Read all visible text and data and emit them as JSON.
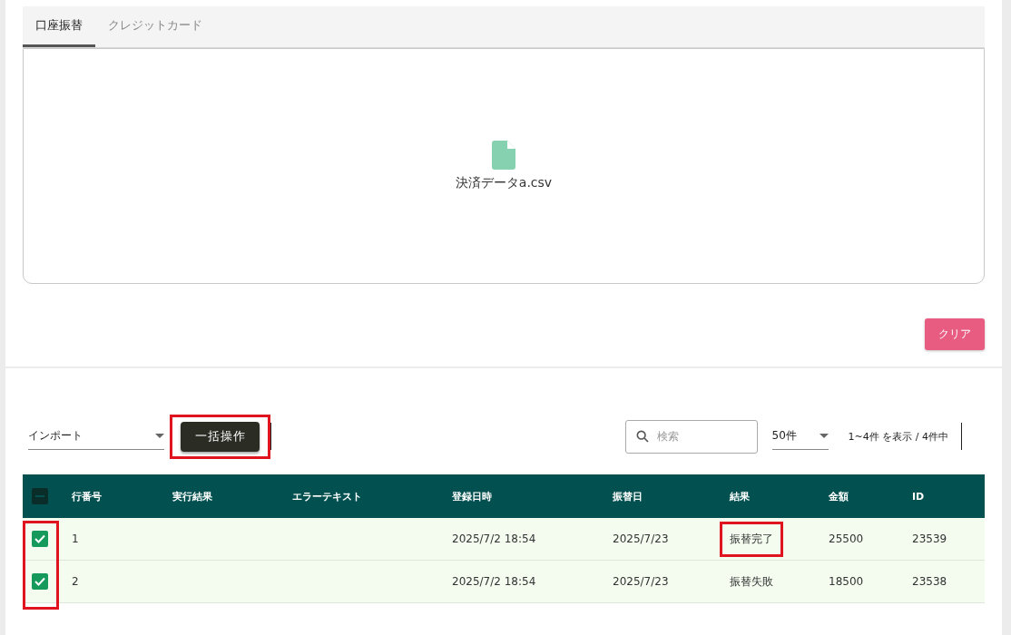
{
  "tabs": [
    {
      "label": "口座振替",
      "selected": true
    },
    {
      "label": "クレジットカード",
      "selected": false
    }
  ],
  "dropzone": {
    "file_name": "決済データa.csv"
  },
  "clear_button": "クリア",
  "toolbar": {
    "action_select": {
      "value": "インポート"
    },
    "bulk_button": {
      "label": "一括操作",
      "highlighted": true
    },
    "search": {
      "placeholder": "検索"
    },
    "page_size": {
      "value": "50件"
    },
    "pagination": "1~4件 を表示 / 4件中"
  },
  "table": {
    "select_all": {
      "indeterminate": true
    },
    "checkbox_column_highlighted": true,
    "columns": [
      "行番号",
      "実行結果",
      "エラーテキスト",
      "登録日時",
      "振替日",
      "結果",
      "金額",
      "ID"
    ],
    "rows": [
      {
        "checked": true,
        "cells": [
          {
            "text": "1"
          },
          {
            "text": ""
          },
          {
            "text": ""
          },
          {
            "text": "2025/7/2 18:54"
          },
          {
            "text": "2025/7/23"
          },
          {
            "text": "振替完了",
            "highlighted": true
          },
          {
            "text": "25500"
          },
          {
            "text": "23539"
          }
        ]
      },
      {
        "checked": true,
        "cells": [
          {
            "text": "2"
          },
          {
            "text": ""
          },
          {
            "text": ""
          },
          {
            "text": "2025/7/2 18:54"
          },
          {
            "text": "2025/7/23"
          },
          {
            "text": "振替失敗",
            "highlighted": false
          },
          {
            "text": "18500"
          },
          {
            "text": "23538"
          }
        ]
      }
    ]
  }
}
